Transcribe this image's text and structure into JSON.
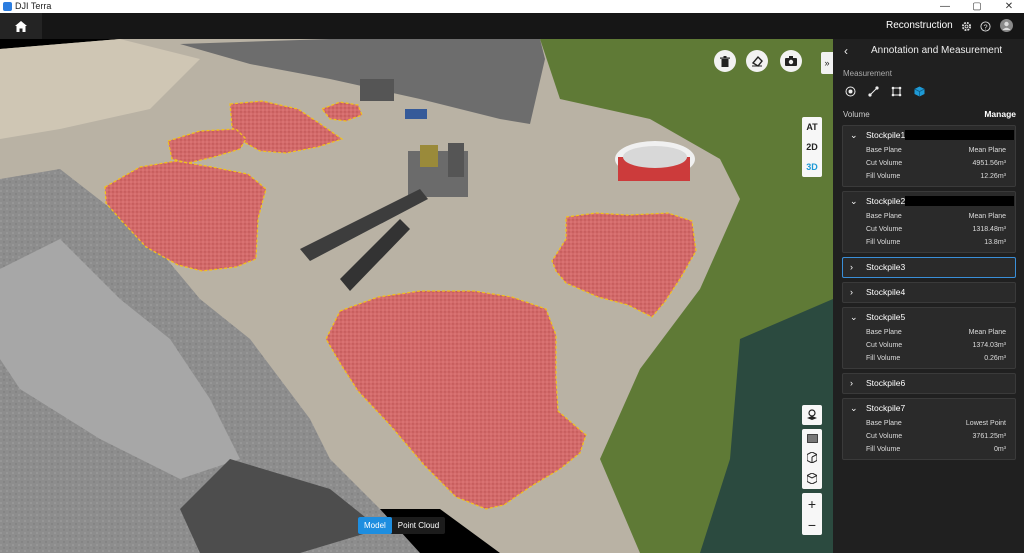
{
  "window": {
    "title": "DJI Terra",
    "controls": [
      "—",
      "▢",
      "✕"
    ]
  },
  "header": {
    "mode_label": "Reconstruction"
  },
  "viewport": {
    "mode_buttons": [
      {
        "label": "AT",
        "active": false
      },
      {
        "label": "2D",
        "active": false
      },
      {
        "label": "3D",
        "active": true
      }
    ],
    "view_toggle": [
      {
        "label": "Model",
        "active": true
      },
      {
        "label": "Point Cloud",
        "active": false
      }
    ],
    "collapse_label": "»",
    "zoom_in": "+",
    "zoom_out": "−"
  },
  "panel": {
    "title": "Annotation and Measurement",
    "back": "‹",
    "measurement_label": "Measurement",
    "volume_label": "Volume",
    "manage_label": "Manage",
    "stockpiles": [
      {
        "name": "Stockpile1",
        "expanded": true,
        "selected": false,
        "base_plane": "Mean Plane",
        "cut_volume": "4951.56m³",
        "fill_volume": "12.26m³"
      },
      {
        "name": "Stockpile2",
        "expanded": true,
        "selected": false,
        "base_plane": "Mean Plane",
        "cut_volume": "1318.48m³",
        "fill_volume": "13.8m³"
      },
      {
        "name": "Stockpile3",
        "expanded": false,
        "selected": true
      },
      {
        "name": "Stockpile4",
        "expanded": false,
        "selected": false
      },
      {
        "name": "Stockpile5",
        "expanded": true,
        "selected": false,
        "base_plane": "Mean Plane",
        "cut_volume": "1374.03m³",
        "fill_volume": "0.26m³"
      },
      {
        "name": "Stockpile6",
        "expanded": false,
        "selected": false
      },
      {
        "name": "Stockpile7",
        "expanded": true,
        "selected": false,
        "base_plane": "Lowest Point",
        "cut_volume": "3761.25m³",
        "fill_volume": "0m³"
      }
    ],
    "row_labels": {
      "base_plane": "Base Plane",
      "cut_volume": "Cut Volume",
      "fill_volume": "Fill Volume"
    }
  },
  "colors": {
    "accent": "#1e8ee0",
    "stockpile_fill": "#e25b5b",
    "stockpile_outline": "#f0c020"
  }
}
